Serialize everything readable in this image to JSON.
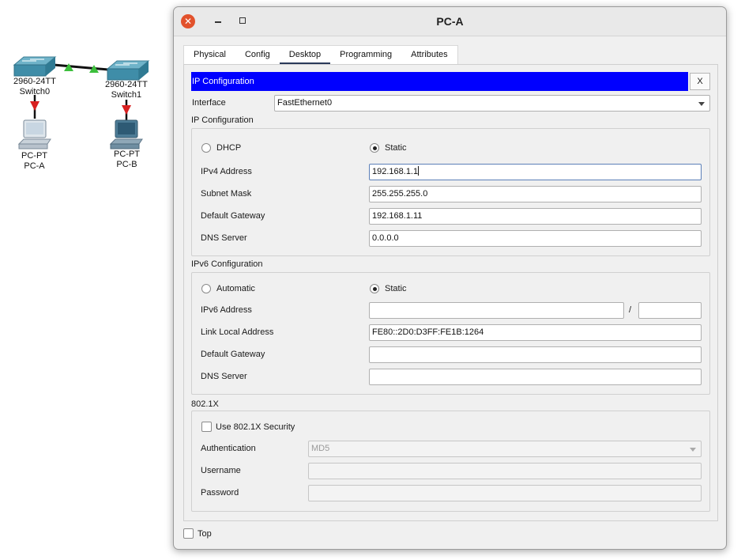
{
  "topology": {
    "switch0": {
      "model": "2960-24TT",
      "name": "Switch0"
    },
    "switch1": {
      "model": "2960-24TT",
      "name": "Switch1"
    },
    "pc_a": {
      "type": "PC-PT",
      "name": "PC-A"
    },
    "pc_b": {
      "type": "PC-PT",
      "name": "PC-B"
    }
  },
  "window": {
    "title": "PC-A",
    "close_glyph": "✕",
    "tabs": [
      "Physical",
      "Config",
      "Desktop",
      "Programming",
      "Attributes"
    ],
    "active_tab": "Desktop"
  },
  "ip_config": {
    "header": "IP Configuration",
    "close_label": "X",
    "interface_label": "Interface",
    "interface_value": "FastEthernet0",
    "ipv4_section": "IP Configuration",
    "dhcp_label": "DHCP",
    "static_label": "Static",
    "ipv4_address_label": "IPv4 Address",
    "ipv4_address": "192.168.1.1",
    "subnet_mask_label": "Subnet Mask",
    "subnet_mask": "255.255.255.0",
    "gateway_label": "Default Gateway",
    "gateway": "192.168.1.11",
    "dns_label": "DNS Server",
    "dns": "0.0.0.0",
    "ipv6_section": "IPv6 Configuration",
    "automatic_label": "Automatic",
    "ipv6_static_label": "Static",
    "ipv6_address_label": "IPv6 Address",
    "ipv6_address": "",
    "prefix_separator": "/",
    "ipv6_prefix": "",
    "link_local_label": "Link Local Address",
    "link_local": "FE80::2D0:D3FF:FE1B:1264",
    "ipv6_gateway_label": "Default Gateway",
    "ipv6_gateway": "",
    "ipv6_dns_label": "DNS Server",
    "ipv6_dns": "",
    "dot1x_section": "802.1X",
    "use_dot1x_label": "Use 802.1X Security",
    "authentication_label": "Authentication",
    "authentication_value": "MD5",
    "username_label": "Username",
    "username": "",
    "password_label": "Password",
    "password": ""
  },
  "footer": {
    "top_label": "Top"
  },
  "colors": {
    "header_bar": "#0000ff",
    "close_button": "#e2522c",
    "link_up": "#22b022",
    "link_down": "#d01010"
  }
}
